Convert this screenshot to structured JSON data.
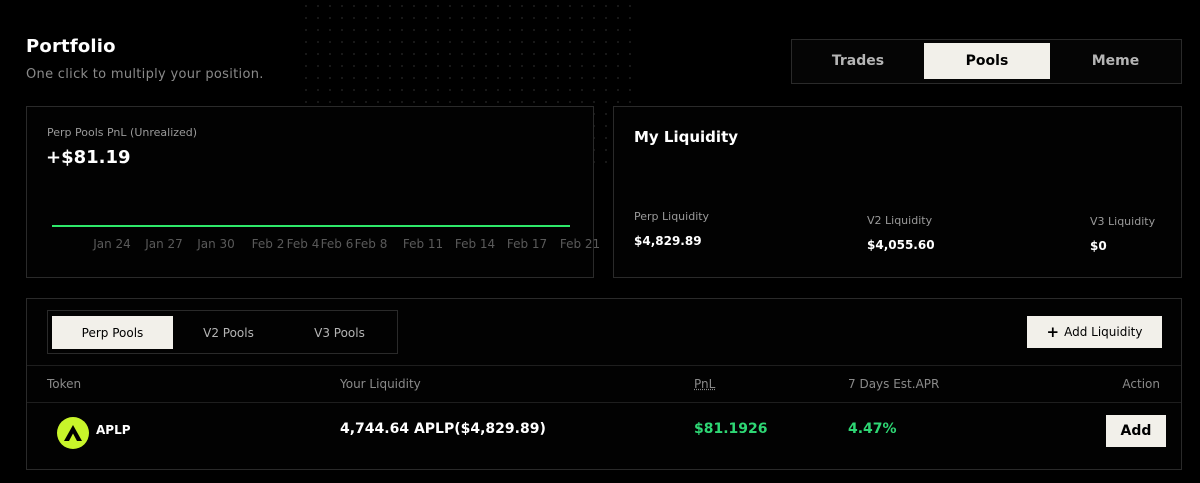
{
  "header": {
    "title": "Portfolio",
    "subtitle": "One click to multiply your position."
  },
  "tabs": [
    "Trades",
    "Pools",
    "Meme"
  ],
  "active_tab": "Pools",
  "pnl_card": {
    "label": "Perp Pools PnL (Unrealized)",
    "value": "+$81.19",
    "line_color": "#2ee86a",
    "x_ticks": [
      "Jan 24",
      "Jan 27",
      "Jan 30",
      "Feb 2",
      "Feb 4",
      "Feb 6",
      "Feb 8",
      "Feb 11",
      "Feb 14",
      "Feb 17",
      "Feb 21"
    ]
  },
  "liquidity": {
    "title": "My Liquidity",
    "items": [
      {
        "label": "Perp Liquidity",
        "value": "$4,829.89"
      },
      {
        "label": "V2 Liquidity",
        "value": "$4,055.60"
      },
      {
        "label": "V3 Liquidity",
        "value": "$0"
      }
    ]
  },
  "pools": {
    "tabs": [
      "Perp Pools",
      "V2 Pools",
      "V3 Pools"
    ],
    "active_tab": "Perp Pools",
    "add_liquidity_label": "Add Liquidity",
    "columns": [
      "Token",
      "Your Liquidity",
      "PnL",
      "7 Days Est.APR",
      "Action"
    ],
    "rows": [
      {
        "token": "APLP",
        "liquidity": "4,744.64 APLP($4,829.89)",
        "pnl": "$81.1926",
        "apr": "4.47%",
        "action": "Add"
      }
    ]
  },
  "colors": {
    "accent_green": "#2ed774",
    "token_icon": "#c8f52a",
    "active_tab_bg": "#f2f0ea"
  }
}
